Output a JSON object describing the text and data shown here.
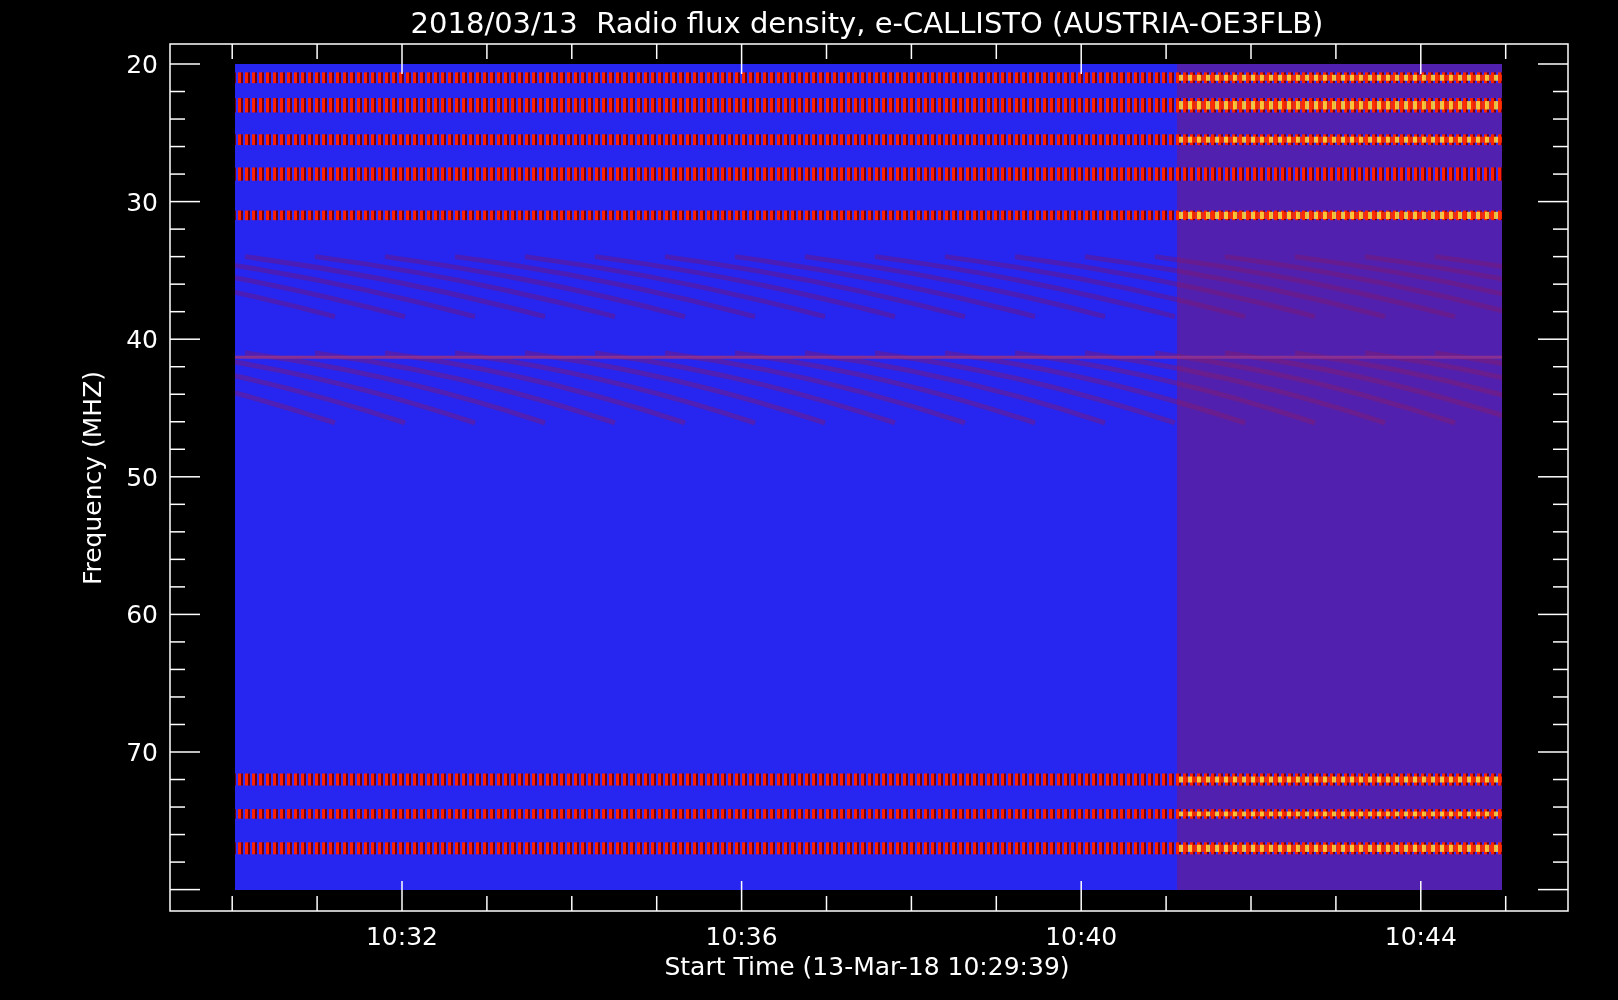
{
  "title": "2018/03/13  Radio flux density, e-CALLISTO (AUSTRIA-OE3FLB)",
  "y_axis": {
    "label": "Frequency (MHZ)",
    "ticks": [
      "20",
      "30",
      "40",
      "50",
      "60",
      "70"
    ]
  },
  "x_axis": {
    "label": "Start Time (13-Mar-18 10:29:39)",
    "ticks": [
      "10:32",
      "10:36",
      "10:40",
      "10:44"
    ]
  }
}
